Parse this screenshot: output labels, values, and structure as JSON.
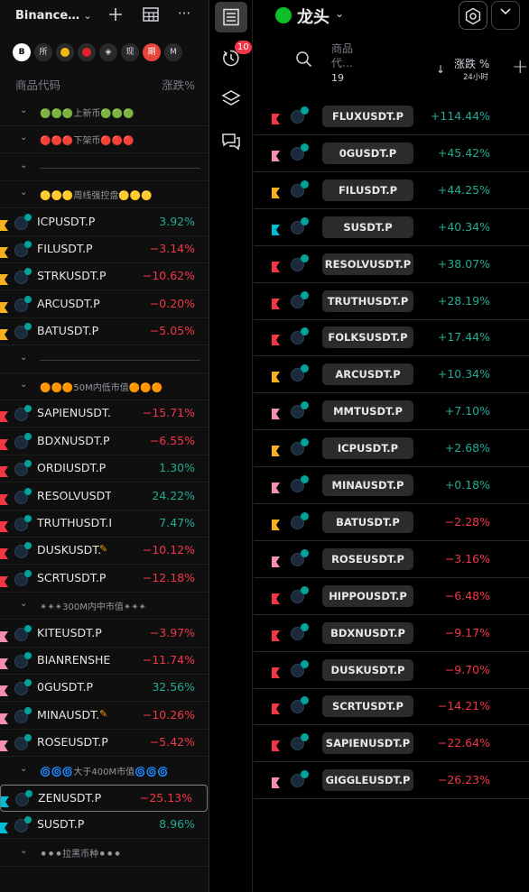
{
  "left_panel": {
    "title": "Binance…",
    "chips": [
      {
        "label": "B",
        "sel": true,
        "icon": "binance-chip"
      },
      {
        "label": "所",
        "icon": "exchange-chip"
      },
      {
        "label": "",
        "icon": "gold-chip",
        "color": "#f0b90b"
      },
      {
        "label": "",
        "icon": "red-chip",
        "color": "#e3202e"
      },
      {
        "label": "◈",
        "icon": "blue-chip"
      },
      {
        "label": "现",
        "icon": "spot-chip"
      },
      {
        "label": "期",
        "icon": "futures-chip",
        "color": "#e8443a"
      },
      {
        "label": "M",
        "icon": "m-chip"
      }
    ],
    "header": {
      "symbol_col": "商品代码",
      "change_col": "涨跌%"
    },
    "rows": [
      {
        "kind": "section",
        "label": "🟢🟢🟢上新币🟢🟢🟢"
      },
      {
        "kind": "section",
        "label": "🔴🔴🔴下架币🔴🔴🔴"
      },
      {
        "kind": "separator"
      },
      {
        "kind": "section",
        "label": "🟡🟡🟡周线强控盘🟡🟡🟡"
      },
      {
        "kind": "symbol",
        "name": "ICPUSDT.P",
        "change": "3.92%",
        "dir": "up",
        "flag": "#f7b01e"
      },
      {
        "kind": "symbol",
        "name": "FILUSDT.P",
        "change": "−3.14%",
        "dir": "down",
        "flag": "#f7b01e"
      },
      {
        "kind": "symbol",
        "name": "STRKUSDT.P",
        "change": "−10.62%",
        "dir": "down",
        "flag": "#f7b01e"
      },
      {
        "kind": "symbol",
        "name": "ARCUSDT.P",
        "change": "−0.20%",
        "dir": "down",
        "flag": "#f7b01e"
      },
      {
        "kind": "symbol",
        "name": "BATUSDT.P",
        "change": "−5.05%",
        "dir": "down",
        "flag": "#f7b01e"
      },
      {
        "kind": "separator"
      },
      {
        "kind": "section",
        "label": "🟠🟠🟠50M内低市值🟠🟠🟠"
      },
      {
        "kind": "symbol",
        "name": "SAPIENUSDT.I",
        "change": "−15.71%",
        "dir": "down",
        "flag": "#f23645"
      },
      {
        "kind": "symbol",
        "name": "BDXNUSDT.P",
        "change": "−6.55%",
        "dir": "down",
        "flag": "#f23645"
      },
      {
        "kind": "symbol",
        "name": "ORDIUSDT.P",
        "change": "1.30%",
        "dir": "up",
        "flag": "#f23645"
      },
      {
        "kind": "symbol",
        "name": "RESOLVUSDT.",
        "change": "24.22%",
        "dir": "up",
        "flag": "#f23645"
      },
      {
        "kind": "symbol",
        "name": "TRUTHUSDT.I",
        "change": "7.47%",
        "dir": "up",
        "flag": "#f23645"
      },
      {
        "kind": "symbol",
        "name": "DUSKUSDT.",
        "change": "−10.12%",
        "dir": "down",
        "flag": "#f23645",
        "edit": true
      },
      {
        "kind": "symbol",
        "name": "SCRTUSDT.P",
        "change": "−12.18%",
        "dir": "down",
        "flag": "#f23645"
      },
      {
        "kind": "section",
        "label": "✴✴✴300M内中市值✴✴✴"
      },
      {
        "kind": "symbol",
        "name": "KITEUSDT.P",
        "change": "−3.97%",
        "dir": "down",
        "flag": "#f48fb1"
      },
      {
        "kind": "symbol",
        "name": "BIANRENSHEN",
        "change": "−11.74%",
        "dir": "down",
        "flag": "#f48fb1"
      },
      {
        "kind": "symbol",
        "name": "0GUSDT.P",
        "change": "32.56%",
        "dir": "up",
        "flag": "#f48fb1"
      },
      {
        "kind": "symbol",
        "name": "MINAUSDT.",
        "change": "−10.26%",
        "dir": "down",
        "flag": "#f48fb1",
        "edit": true
      },
      {
        "kind": "symbol",
        "name": "ROSEUSDT.P",
        "change": "−5.42%",
        "dir": "down",
        "flag": "#f48fb1"
      },
      {
        "kind": "section",
        "label": "🌀🌀🌀大于400M市值🌀🌀🌀"
      },
      {
        "kind": "symbol",
        "name": "ZENUSDT.P",
        "change": "−25.13%",
        "dir": "down",
        "flag": "#00bcd4",
        "selected": true
      },
      {
        "kind": "symbol",
        "name": "SUSDT.P",
        "change": "8.96%",
        "dir": "up",
        "flag": "#00bcd4"
      },
      {
        "kind": "section",
        "label": "⚫⚫⚫拉黑币种⚫⚫⚫"
      }
    ]
  },
  "toolbar": {
    "items": [
      {
        "icon": "watchlist-icon",
        "active": true
      },
      {
        "icon": "alerts-clock-icon",
        "badge": "10"
      },
      {
        "icon": "layers-icon"
      },
      {
        "icon": "chat-icon"
      }
    ]
  },
  "right_panel": {
    "list_name": "龙头",
    "header": {
      "symbol_col": "商品代…",
      "count": "19",
      "change_col": "涨跌 %",
      "period": "24小时"
    },
    "rows": [
      {
        "name": "FLUXUSDT.P",
        "change": "+114.44%",
        "dir": "up",
        "flag": "#f23645"
      },
      {
        "name": "0GUSDT.P",
        "change": "+45.42%",
        "dir": "up",
        "flag": "#f48fb1"
      },
      {
        "name": "FILUSDT.P",
        "change": "+44.25%",
        "dir": "up",
        "flag": "#f7b01e"
      },
      {
        "name": "SUSDT.P",
        "change": "+40.34%",
        "dir": "up",
        "flag": "#00bcd4"
      },
      {
        "name": "RESOLVUSDT.P",
        "change": "+38.07%",
        "dir": "up",
        "flag": "#f23645"
      },
      {
        "name": "TRUTHUSDT.P",
        "change": "+28.19%",
        "dir": "up",
        "flag": "#f23645"
      },
      {
        "name": "FOLKSUSDT.P",
        "change": "+17.44%",
        "dir": "up",
        "flag": "#f23645"
      },
      {
        "name": "ARCUSDT.P",
        "change": "+10.34%",
        "dir": "up",
        "flag": "#f7b01e"
      },
      {
        "name": "MMTUSDT.P",
        "change": "+7.10%",
        "dir": "up",
        "flag": "#f48fb1"
      },
      {
        "name": "ICPUSDT.P",
        "change": "+2.68%",
        "dir": "up",
        "flag": "#f7b01e"
      },
      {
        "name": "MINAUSDT.P",
        "change": "+0.18%",
        "dir": "up",
        "flag": "#f48fb1"
      },
      {
        "name": "BATUSDT.P",
        "change": "−2.28%",
        "dir": "down",
        "flag": "#f7b01e"
      },
      {
        "name": "ROSEUSDT.P",
        "change": "−3.16%",
        "dir": "down",
        "flag": "#f48fb1"
      },
      {
        "name": "HIPPOUSDT.P",
        "change": "−6.48%",
        "dir": "down",
        "flag": "#f23645"
      },
      {
        "name": "BDXNUSDT.P",
        "change": "−9.17%",
        "dir": "down",
        "flag": "#f23645"
      },
      {
        "name": "DUSKUSDT.P",
        "change": "−9.70%",
        "dir": "down",
        "flag": "#f23645"
      },
      {
        "name": "SCRTUSDT.P",
        "change": "−14.21%",
        "dir": "down",
        "flag": "#f23645"
      },
      {
        "name": "SAPIENUSDT.P",
        "change": "−22.64%",
        "dir": "down",
        "flag": "#f23645"
      },
      {
        "name": "GIGGLEUSDT.P",
        "change": "−26.23%",
        "dir": "down",
        "flag": "#f48fb1"
      }
    ]
  }
}
